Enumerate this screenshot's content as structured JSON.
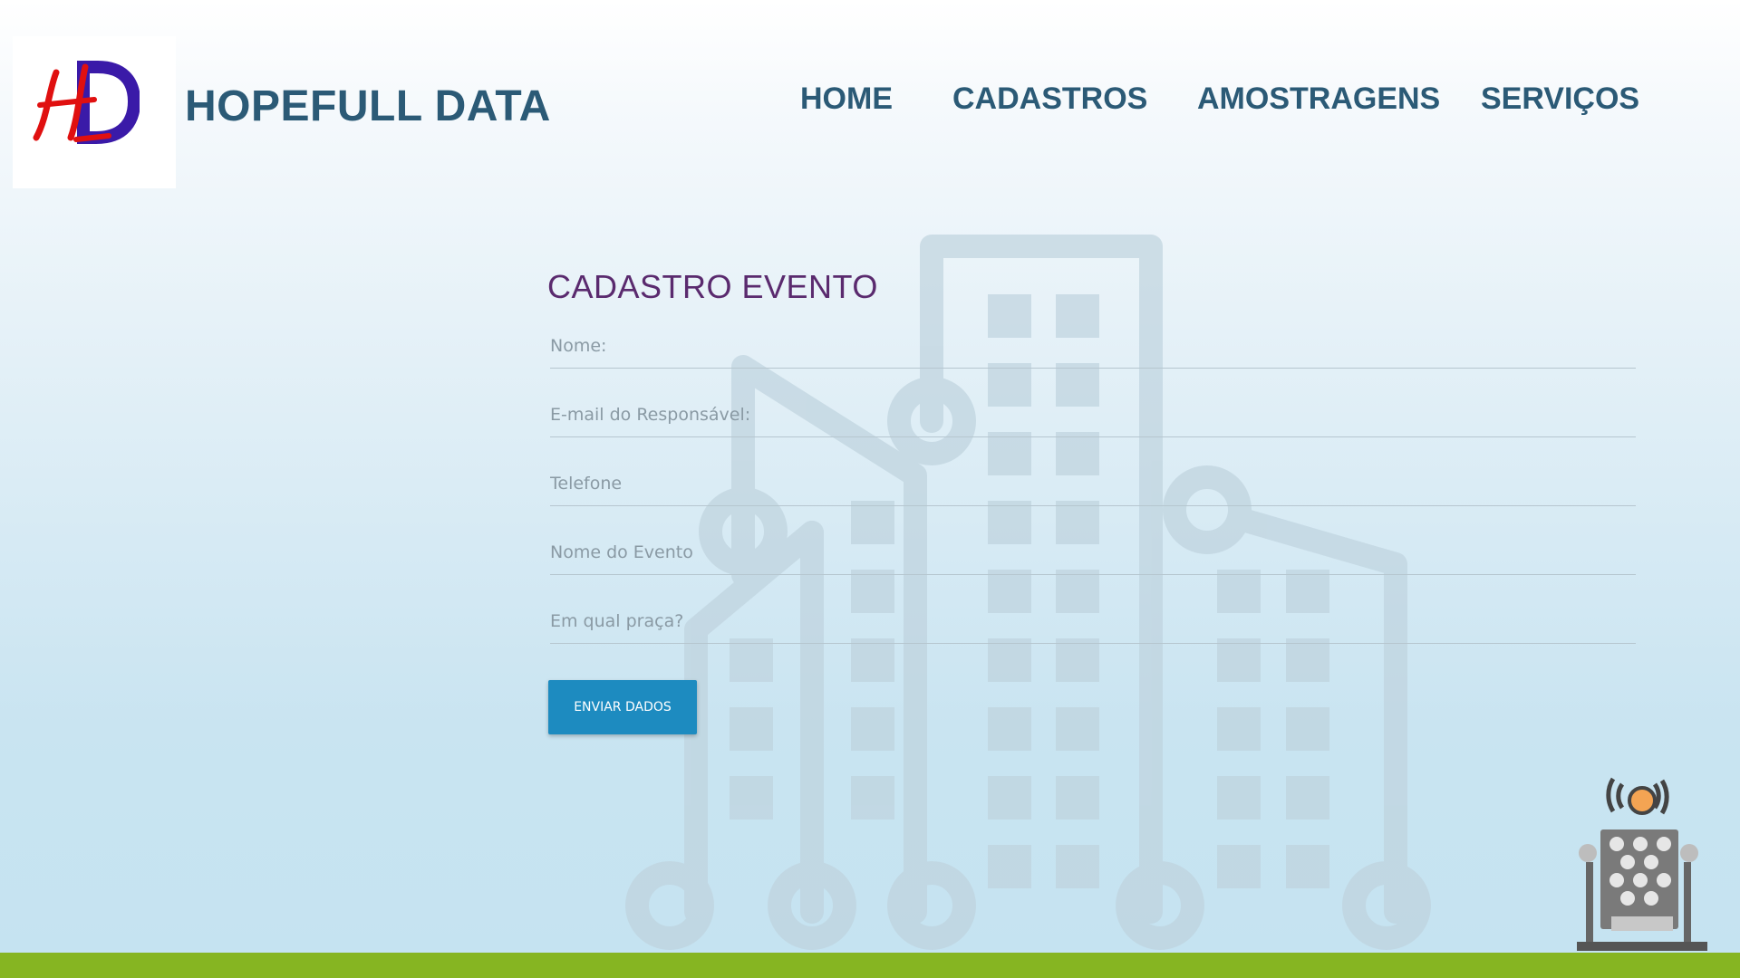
{
  "brand": {
    "name": "HOPEFULL DATA",
    "logo_icon": "hd-monogram-logo"
  },
  "nav": {
    "items": [
      {
        "label": "HOME"
      },
      {
        "label": "CADASTROS"
      },
      {
        "label": "AMOSTRAGENS"
      },
      {
        "label": "SERVIÇOS"
      }
    ]
  },
  "form": {
    "title": "CADASTRO EVENTO",
    "fields": [
      {
        "placeholder": "Nome:",
        "value": ""
      },
      {
        "placeholder": "E-mail do Responsável:",
        "value": ""
      },
      {
        "placeholder": "Telefone",
        "value": ""
      },
      {
        "placeholder": "Nome do Evento",
        "value": ""
      },
      {
        "placeholder": "Em qual praça?",
        "value": ""
      }
    ],
    "submit_label": "ENVIAR DADOS"
  },
  "decor": {
    "background_icon": "city-buildings-icon",
    "corner_icon": "broadcast-robot-icon"
  },
  "colors": {
    "brand_text": "#2b5a76",
    "title": "#5a2a6e",
    "button": "#1d8bc0",
    "footer": "#86b522"
  }
}
